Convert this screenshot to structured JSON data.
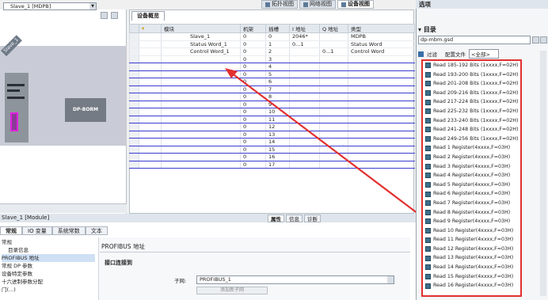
{
  "view_tabs": [
    {
      "label": "拓扑视图",
      "icon": "topology-icon",
      "active": false
    },
    {
      "label": "网络视图",
      "icon": "network-icon",
      "active": false
    },
    {
      "label": "设备视图",
      "icon": "device-icon",
      "active": true
    }
  ],
  "device_view": {
    "selected_device": "Slave_1 [MDPB]",
    "rack_label": "Slave_1",
    "module_label": "DP-BORM"
  },
  "overview": {
    "tab_label": "设备概览",
    "columns": [
      "模块",
      "机架",
      "插槽",
      "I 地址",
      "Q 地址",
      "类型"
    ],
    "rows": [
      {
        "module": "Slave_1",
        "rack": "0",
        "slot": "0",
        "i_addr": "2046*",
        "q_addr": "",
        "type": "MDPB"
      },
      {
        "module": "Status Word_1",
        "rack": "0",
        "slot": "1",
        "i_addr": "0...1",
        "q_addr": "",
        "type": "Status Word"
      },
      {
        "module": "Control Word_1",
        "rack": "0",
        "slot": "2",
        "i_addr": "",
        "q_addr": "0...1",
        "type": "Control Word"
      },
      {
        "module": "",
        "rack": "0",
        "slot": "3",
        "i_addr": "",
        "q_addr": "",
        "type": ""
      },
      {
        "module": "",
        "rack": "0",
        "slot": "4",
        "i_addr": "",
        "q_addr": "",
        "type": ""
      },
      {
        "module": "",
        "rack": "0",
        "slot": "5",
        "i_addr": "",
        "q_addr": "",
        "type": ""
      },
      {
        "module": "",
        "rack": "0",
        "slot": "6",
        "i_addr": "",
        "q_addr": "",
        "type": ""
      },
      {
        "module": "",
        "rack": "0",
        "slot": "7",
        "i_addr": "",
        "q_addr": "",
        "type": ""
      },
      {
        "module": "",
        "rack": "0",
        "slot": "8",
        "i_addr": "",
        "q_addr": "",
        "type": ""
      },
      {
        "module": "",
        "rack": "0",
        "slot": "9",
        "i_addr": "",
        "q_addr": "",
        "type": ""
      },
      {
        "module": "",
        "rack": "0",
        "slot": "10",
        "i_addr": "",
        "q_addr": "",
        "type": ""
      },
      {
        "module": "",
        "rack": "0",
        "slot": "11",
        "i_addr": "",
        "q_addr": "",
        "type": ""
      },
      {
        "module": "",
        "rack": "0",
        "slot": "12",
        "i_addr": "",
        "q_addr": "",
        "type": ""
      },
      {
        "module": "",
        "rack": "0",
        "slot": "13",
        "i_addr": "",
        "q_addr": "",
        "type": ""
      },
      {
        "module": "",
        "rack": "0",
        "slot": "14",
        "i_addr": "",
        "q_addr": "",
        "type": ""
      },
      {
        "module": "",
        "rack": "0",
        "slot": "15",
        "i_addr": "",
        "q_addr": "",
        "type": ""
      },
      {
        "module": "",
        "rack": "0",
        "slot": "16",
        "i_addr": "",
        "q_addr": "",
        "type": ""
      },
      {
        "module": "",
        "rack": "0",
        "slot": "17",
        "i_addr": "",
        "q_addr": "",
        "type": ""
      }
    ]
  },
  "catalog": {
    "title": "选项",
    "directory_label": "目录",
    "search_value": "dp-mbm.gsd",
    "filter_label": "过滤",
    "profile_label": "配置文件",
    "profile_value": "<全部>",
    "items": [
      "Read 185-192 Bits (1xxxx,F=02H)",
      "Read 193-200 Bits (1xxxx,F=02H)",
      "Read 201-208 Bits (1xxxx,F=02H)",
      "Read 209-216 Bits (1xxxx,F=02H)",
      "Read 217-224 Bits (1xxxx,F=02H)",
      "Read 225-232 Bits (1xxxx,F=02H)",
      "Read 233-240 Bits (1xxxx,F=02H)",
      "Read 241-248 Bits (1xxxx,F=02H)",
      "Read 249-256 Bits (1xxxx,F=02H)",
      "Read 1 Register(4xxxx,F=03H)",
      "Read 2 Register(4xxxx,F=03H)",
      "Read 3 Register(4xxxx,F=03H)",
      "Read 4 Register(4xxxx,F=03H)",
      "Read 5 Register(4xxxx,F=03H)",
      "Read 6 Register(4xxxx,F=03H)",
      "Read 7 Register(4xxxx,F=03H)",
      "Read 8 Register(4xxxx,F=03H)",
      "Read 9 Register(4xxxx,F=03H)",
      "Read 10 Register(4xxxx,F=03H)",
      "Read 11 Register(4xxxx,F=03H)",
      "Read 12 Register(4xxxx,F=03H)",
      "Read 13 Register(4xxxx,F=03H)",
      "Read 14 Register(4xxxx,F=03H)",
      "Read 15 Register(4xxxx,F=03H)",
      "Read 16 Register(4xxxx,F=03H)"
    ]
  },
  "inspector": {
    "title": "Slave_1 [Module]",
    "tabs": [
      "属性",
      "信息",
      "诊断"
    ],
    "sub_tabs": [
      "常规",
      "IO 变量",
      "系统常数",
      "文本"
    ],
    "nav": [
      "常规",
      "目录信息",
      "PROFIBUS 地址",
      "常规 DP 参数",
      "设备特定参数",
      "十六进制参数分配",
      "门(...)"
    ],
    "section_title": "PROFIBUS 地址",
    "section_sub": "接口连接到",
    "subnet_label": "子网:",
    "subnet_value": "PROFIBUS_1",
    "add_subnet_label": "添加新子网"
  },
  "colors": {
    "annotation_red": "#e23030",
    "empty_slot_line": "#3b3bd1"
  }
}
